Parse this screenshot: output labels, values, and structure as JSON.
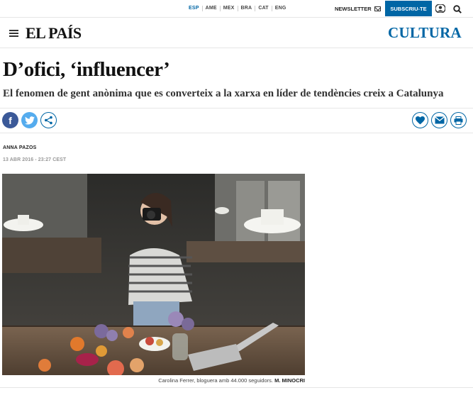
{
  "topbar": {
    "editions": [
      "ESP",
      "AME",
      "MEX",
      "BRA",
      "CAT",
      "ENG"
    ],
    "newsletter_label": "NEWSLETTER",
    "subscribe_label": "SUBSCRIU-TE",
    "icons": [
      "envelope-icon",
      "user-icon",
      "search-icon"
    ]
  },
  "header": {
    "logo": "EL PAÍS",
    "section": "CULTURA",
    "icons": [
      "menu-icon"
    ]
  },
  "article": {
    "headline": "D’ofici, ‘influencer’",
    "subheadline": "El fenomen de gent anònima que es converteix a la xarxa en líder de tendències creix a Catalunya",
    "author": "ANNA PAZOS",
    "date": "13 ABR 2016 - 23:27 CEST",
    "caption": "Carolina Ferrer, bloguera amb 44.000 seguidors.",
    "photo_credit": "M. MINOCRI"
  },
  "share": {
    "left_icons": [
      "facebook-icon",
      "twitter-icon",
      "share-icon"
    ],
    "right_icons": [
      "heart-icon",
      "mail-icon",
      "print-icon"
    ]
  },
  "colors": {
    "brand_blue": "#0066a5",
    "facebook": "#3b5998",
    "twitter": "#55acee"
  }
}
